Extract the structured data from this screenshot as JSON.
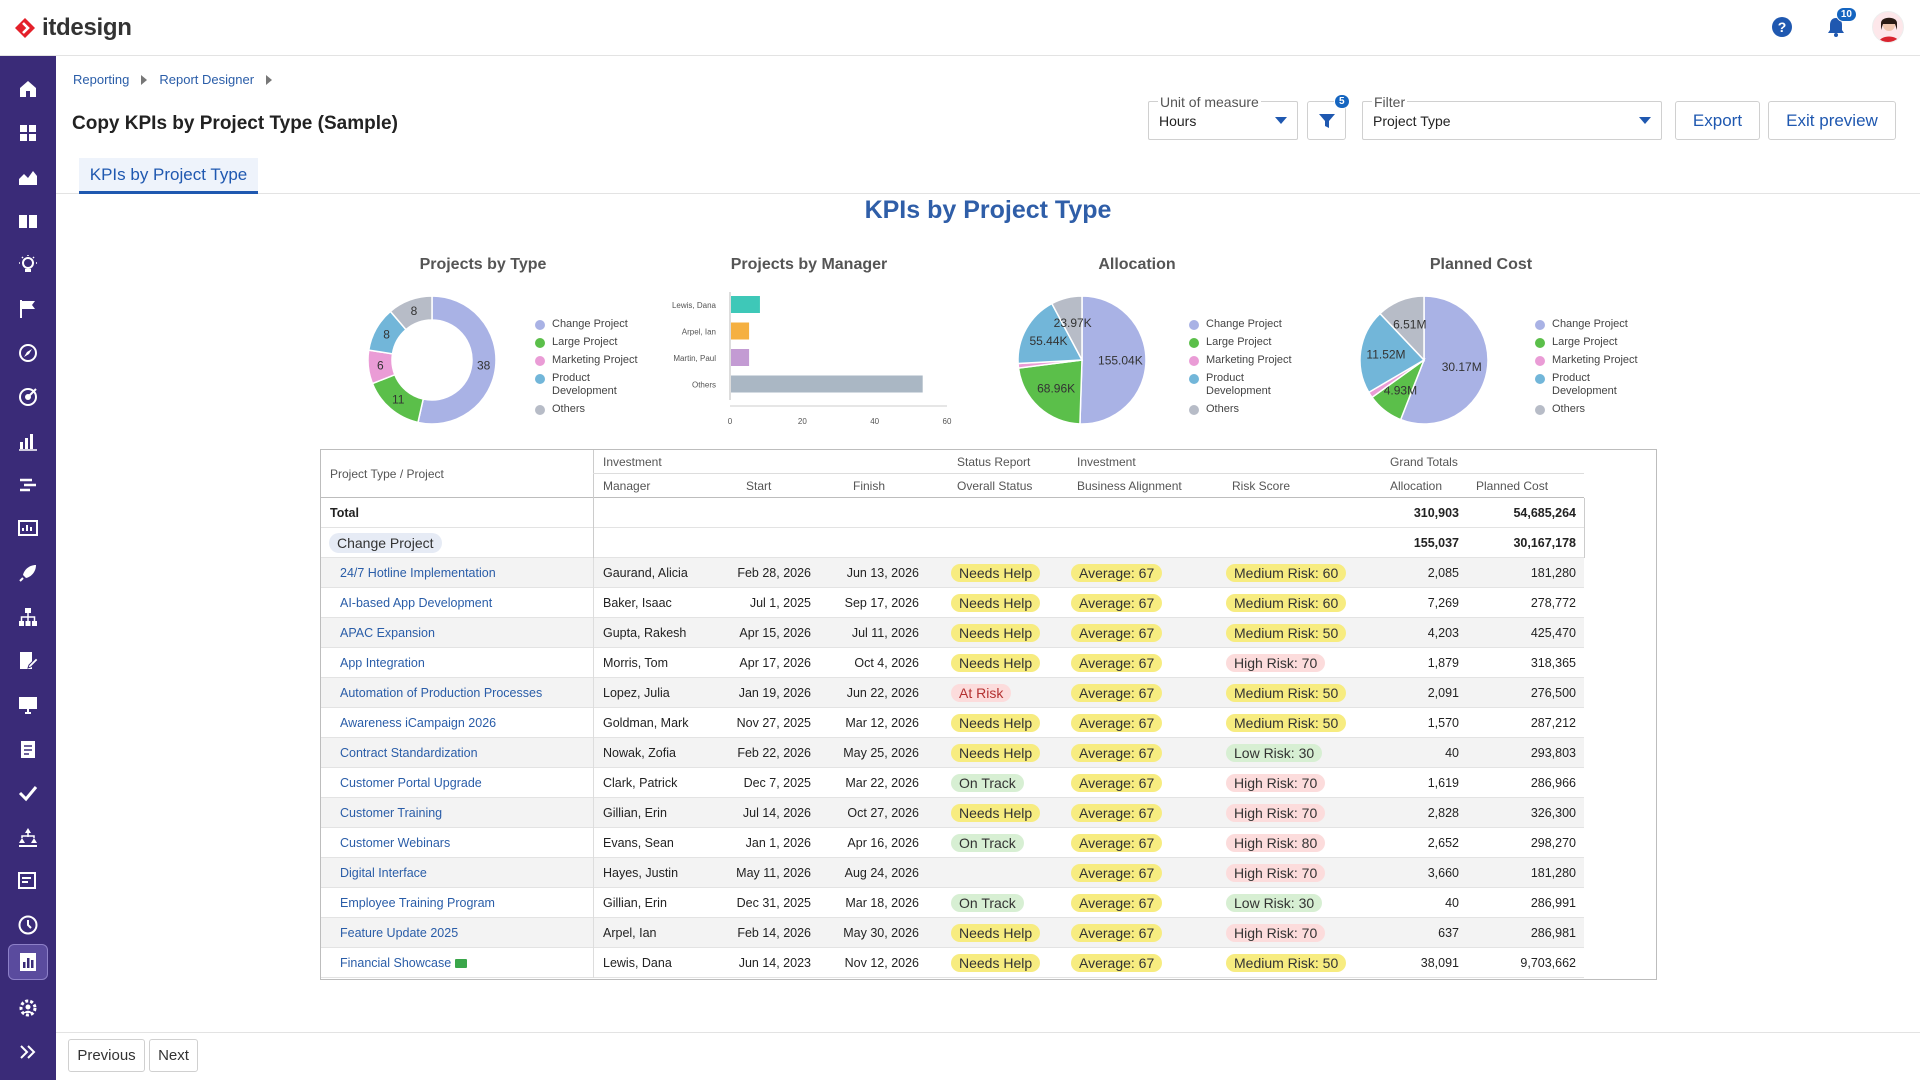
{
  "app": {
    "logo_text": "itdesign",
    "notification_count": "10"
  },
  "breadcrumb": [
    "Reporting",
    "Report Designer"
  ],
  "page_title": "Copy KPIs by Project Type (Sample)",
  "controls": {
    "unit_label": "Unit of measure",
    "unit_value": "Hours",
    "filter_badge": "5",
    "filter_label": "Filter",
    "filter_value": "Project Type",
    "export_label": "Export",
    "exit_label": "Exit preview"
  },
  "tab_label": "KPIs by Project Type",
  "report_title": "KPIs by Project Type",
  "colors": {
    "Change Project": "#a9b2e5",
    "Large Project": "#5bbf4a",
    "Marketing Project": "#ea9cd6",
    "Product Development": "#72b6d9",
    "Others": "#b7bcc7"
  },
  "legend_labels": [
    "Change Project",
    "Large Project",
    "Marketing Project",
    "Product Development",
    "Others"
  ],
  "chart_data": [
    {
      "type": "pie",
      "variant": "donut",
      "title": "Projects by Type",
      "labels": [
        "Change Project",
        "Large Project",
        "Marketing Project",
        "Product Development",
        "Others"
      ],
      "values": [
        38,
        11,
        6,
        8,
        8
      ],
      "value_labels": [
        "38",
        "11",
        "6",
        "8",
        "8"
      ],
      "legend": "right"
    },
    {
      "type": "bar",
      "orientation": "horizontal",
      "title": "Projects by Manager",
      "categories": [
        "Lewis, Dana",
        "Arpel, Ian",
        "Martin, Paul",
        "Others"
      ],
      "values": [
        8,
        5,
        5,
        53
      ],
      "bar_colors": [
        "#3ec8b8",
        "#f5b041",
        "#c39bd3",
        "#aab7c4"
      ],
      "xlim": [
        0,
        60
      ],
      "xticks": [
        "0",
        "20",
        "40",
        "60"
      ]
    },
    {
      "type": "pie",
      "title": "Allocation",
      "labels": [
        "Change Project",
        "Large Project",
        "Marketing Project",
        "Product Development",
        "Others"
      ],
      "values": [
        155.04,
        68.96,
        3.5,
        55.44,
        23.97
      ],
      "value_labels": [
        "155.04K",
        "68.96K",
        "",
        "55.44K",
        "23.97K"
      ],
      "legend": "right"
    },
    {
      "type": "pie",
      "title": "Planned Cost",
      "labels": [
        "Change Project",
        "Large Project",
        "Marketing Project",
        "Product Development",
        "Others"
      ],
      "values": [
        30.17,
        4.93,
        0.8,
        11.52,
        6.51
      ],
      "value_labels": [
        "30.17M",
        "4.93M",
        "",
        "11.52M",
        "6.51M"
      ],
      "legend": "right"
    }
  ],
  "table": {
    "row_header": "Project Type / Project",
    "group_headers": [
      "Investment",
      "Status Report",
      "Investment",
      "Grand Totals"
    ],
    "columns": [
      "Manager",
      "Start",
      "Finish",
      "Overall Status",
      "Business Alignment",
      "Risk Score",
      "Allocation",
      "Planned Cost"
    ],
    "total": {
      "label": "Total",
      "allocation": "310,903",
      "cost": "54,685,264"
    },
    "group": {
      "label": "Change Project",
      "allocation": "155,037",
      "cost": "30,167,178"
    },
    "rows": [
      {
        "project": "24/7 Hotline Implementation",
        "manager": "Gaurand, Alicia",
        "start": "Feb 28, 2026",
        "finish": "Jun 13, 2026",
        "status": "Needs Help",
        "status_color": "yellow",
        "alignment": "Average: 67",
        "risk": "Medium Risk: 60",
        "risk_color": "yellow",
        "allocation": "2,085",
        "cost": "181,280"
      },
      {
        "project": "AI-based App Development",
        "manager": "Baker, Isaac",
        "start": "Jul 1, 2025",
        "finish": "Sep 17, 2026",
        "status": "Needs Help",
        "status_color": "yellow",
        "alignment": "Average: 67",
        "risk": "Medium Risk: 60",
        "risk_color": "yellow",
        "allocation": "7,269",
        "cost": "278,772"
      },
      {
        "project": "APAC Expansion",
        "manager": "Gupta, Rakesh",
        "start": "Apr 15, 2026",
        "finish": "Jul 11, 2026",
        "status": "Needs Help",
        "status_color": "yellow",
        "alignment": "Average: 67",
        "risk": "Medium Risk: 50",
        "risk_color": "yellow",
        "allocation": "4,203",
        "cost": "425,470"
      },
      {
        "project": "App Integration",
        "manager": "Morris, Tom",
        "start": "Apr 17, 2026",
        "finish": "Oct 4, 2026",
        "status": "Needs Help",
        "status_color": "yellow",
        "alignment": "Average: 67",
        "risk": "High Risk: 70",
        "risk_color": "red",
        "allocation": "1,879",
        "cost": "318,365"
      },
      {
        "project": "Automation of Production Processes",
        "manager": "Lopez, Julia",
        "start": "Jan 19, 2026",
        "finish": "Jun 22, 2026",
        "status": "At Risk",
        "status_color": "atrisk",
        "alignment": "Average: 67",
        "risk": "Medium Risk: 50",
        "risk_color": "yellow",
        "allocation": "2,091",
        "cost": "276,500"
      },
      {
        "project": "Awareness iCampaign 2026",
        "manager": "Goldman, Mark",
        "start": "Nov 27, 2025",
        "finish": "Mar 12, 2026",
        "status": "Needs Help",
        "status_color": "yellow",
        "alignment": "Average: 67",
        "risk": "Medium Risk: 50",
        "risk_color": "yellow",
        "allocation": "1,570",
        "cost": "287,212"
      },
      {
        "project": "Contract Standardization",
        "manager": "Nowak, Zofia",
        "start": "Feb 22, 2026",
        "finish": "May 25, 2026",
        "status": "Needs Help",
        "status_color": "yellow",
        "alignment": "Average: 67",
        "risk": "Low Risk: 30",
        "risk_color": "green",
        "allocation": "40",
        "cost": "293,803"
      },
      {
        "project": "Customer Portal Upgrade",
        "manager": "Clark, Patrick",
        "start": "Dec 7, 2025",
        "finish": "Mar 22, 2026",
        "status": "On Track",
        "status_color": "green",
        "alignment": "Average: 67",
        "risk": "High Risk: 70",
        "risk_color": "red",
        "allocation": "1,619",
        "cost": "286,966"
      },
      {
        "project": "Customer Training",
        "manager": "Gillian, Erin",
        "start": "Jul 14, 2026",
        "finish": "Oct 27, 2026",
        "status": "Needs Help",
        "status_color": "yellow",
        "alignment": "Average: 67",
        "risk": "High Risk: 70",
        "risk_color": "red",
        "allocation": "2,828",
        "cost": "326,300"
      },
      {
        "project": "Customer Webinars",
        "manager": "Evans, Sean",
        "start": "Jan 1, 2026",
        "finish": "Apr 16, 2026",
        "status": "On Track",
        "status_color": "green",
        "alignment": "Average: 67",
        "risk": "High Risk: 80",
        "risk_color": "red",
        "allocation": "2,652",
        "cost": "298,270"
      },
      {
        "project": "Digital Interface",
        "manager": "Hayes, Justin",
        "start": "May 11, 2026",
        "finish": "Aug 24, 2026",
        "status": "",
        "status_color": "",
        "alignment": "Average: 67",
        "risk": "High Risk: 70",
        "risk_color": "red",
        "allocation": "3,660",
        "cost": "181,280"
      },
      {
        "project": "Employee Training Program",
        "manager": "Gillian, Erin",
        "start": "Dec 31, 2025",
        "finish": "Mar 18, 2026",
        "status": "On Track",
        "status_color": "green",
        "alignment": "Average: 67",
        "risk": "Low Risk: 30",
        "risk_color": "green",
        "allocation": "40",
        "cost": "286,991"
      },
      {
        "project": "Feature Update 2025",
        "manager": "Arpel, Ian",
        "start": "Feb 14, 2026",
        "finish": "May 30, 2026",
        "status": "Needs Help",
        "status_color": "yellow",
        "alignment": "Average: 67",
        "risk": "High Risk: 70",
        "risk_color": "red",
        "allocation": "637",
        "cost": "286,981"
      },
      {
        "project": "Financial Showcase",
        "manager": "Lewis, Dana",
        "start": "Jun 14, 2023",
        "finish": "Nov 12, 2026",
        "status": "Needs Help",
        "status_color": "yellow",
        "alignment": "Average: 67",
        "risk": "Medium Risk: 50",
        "risk_color": "yellow",
        "allocation": "38,091",
        "cost": "9,703,662"
      }
    ]
  },
  "footer": {
    "previous_label": "Previous",
    "next_label": "Next"
  }
}
